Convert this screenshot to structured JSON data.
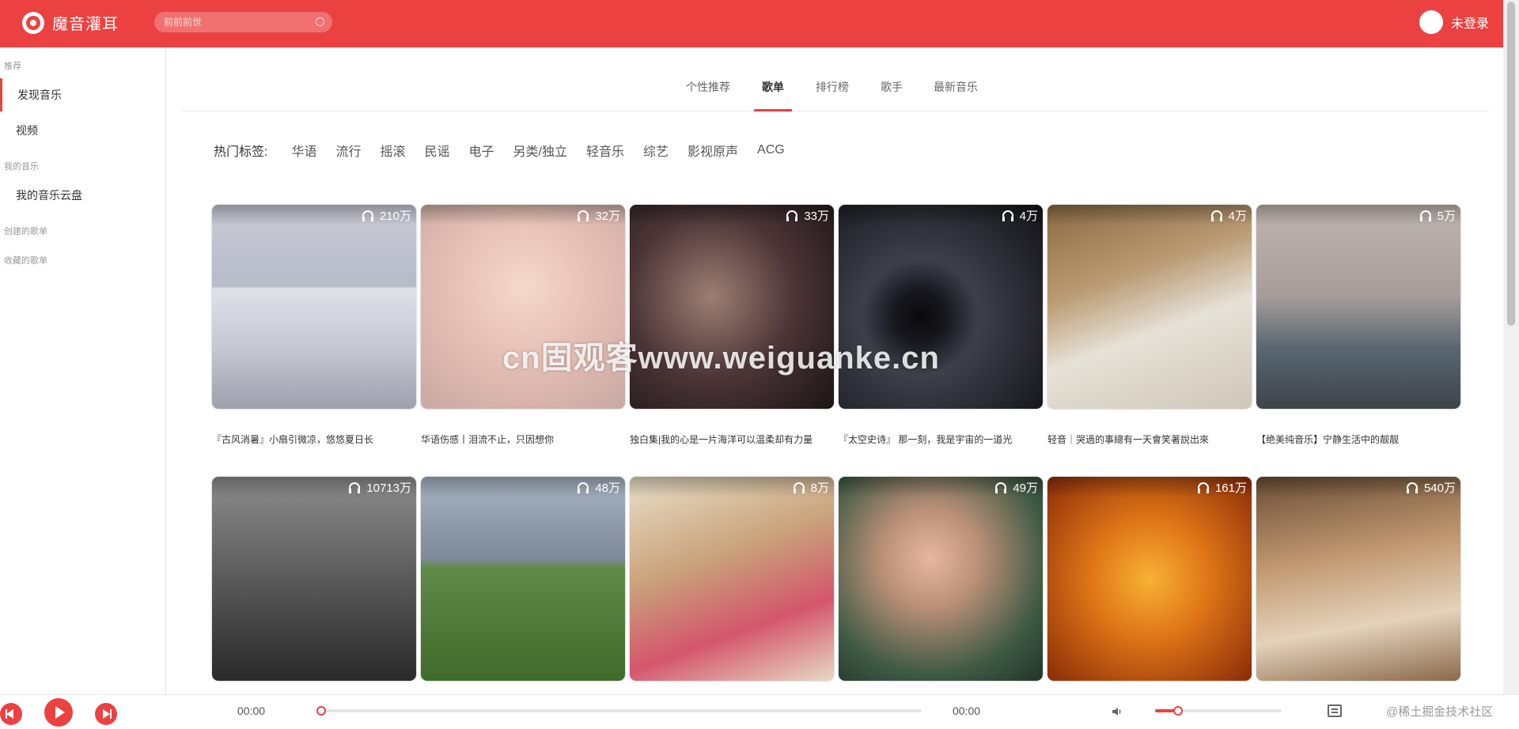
{
  "app": {
    "title": "魔音灌耳"
  },
  "search": {
    "placeholder": "前前前世"
  },
  "user": {
    "name": "未登录"
  },
  "sidebar": {
    "groups": [
      {
        "label": "推荐"
      },
      {
        "label": "我的音乐"
      },
      {
        "label": "创建的歌单"
      },
      {
        "label": "收藏的歌单"
      }
    ],
    "items": [
      {
        "label": "发现音乐",
        "active": true
      },
      {
        "label": "视频",
        "active": false
      },
      {
        "label": "我的音乐云盘",
        "active": false
      }
    ]
  },
  "tabs": [
    {
      "label": "个性推荐",
      "active": false
    },
    {
      "label": "歌单",
      "active": true
    },
    {
      "label": "排行榜",
      "active": false
    },
    {
      "label": "歌手",
      "active": false
    },
    {
      "label": "最新音乐",
      "active": false
    }
  ],
  "hot_tags": {
    "label": "热门标签:",
    "tags": [
      "华语",
      "流行",
      "摇滚",
      "民谣",
      "电子",
      "另类/独立",
      "轻音乐",
      "综艺",
      "影视原声",
      "ACG"
    ]
  },
  "playlists": [
    {
      "count": "210万",
      "title": "『古风消暑』小扇引微凉，悠悠夏日长",
      "cover": "portrait"
    },
    {
      "count": "32万",
      "title": "华语伤感丨泪流不止，只因想你",
      "cover": "anime-girl"
    },
    {
      "count": "33万",
      "title": "独白集|我的心是一片海洋可以温柔却有力量",
      "cover": "shadow-face"
    },
    {
      "count": "4万",
      "title": "『太空史诗』 那一刻，我是宇宙的一道光",
      "cover": "space"
    },
    {
      "count": "4万",
      "title": "轻音｜哭過的事總有一天會笑著說出來",
      "cover": "desk-tea"
    },
    {
      "count": "5万",
      "title": "【绝美纯音乐】宁静生活中的靓靓",
      "cover": "town-sunset"
    },
    {
      "count": "10713万",
      "title": "",
      "cover": "child-cat"
    },
    {
      "count": "48万",
      "title": "",
      "cover": "green-hill"
    },
    {
      "count": "8万",
      "title": "",
      "cover": "anime-boy"
    },
    {
      "count": "49万",
      "title": "",
      "cover": "woman-portrait"
    },
    {
      "count": "161万",
      "title": "",
      "cover": "guitar-silhouette"
    },
    {
      "count": "540万",
      "title": "",
      "cover": "dinner"
    }
  ],
  "watermark": {
    "text": "cn固观客www.weiguanke.cn"
  },
  "player": {
    "current_time": "00:00",
    "total_time": "00:00",
    "progress": 0,
    "volume": 0.18
  },
  "footer": {
    "text": "@稀土掘金技术社区"
  },
  "colors": {
    "accent": "#ec4141"
  }
}
